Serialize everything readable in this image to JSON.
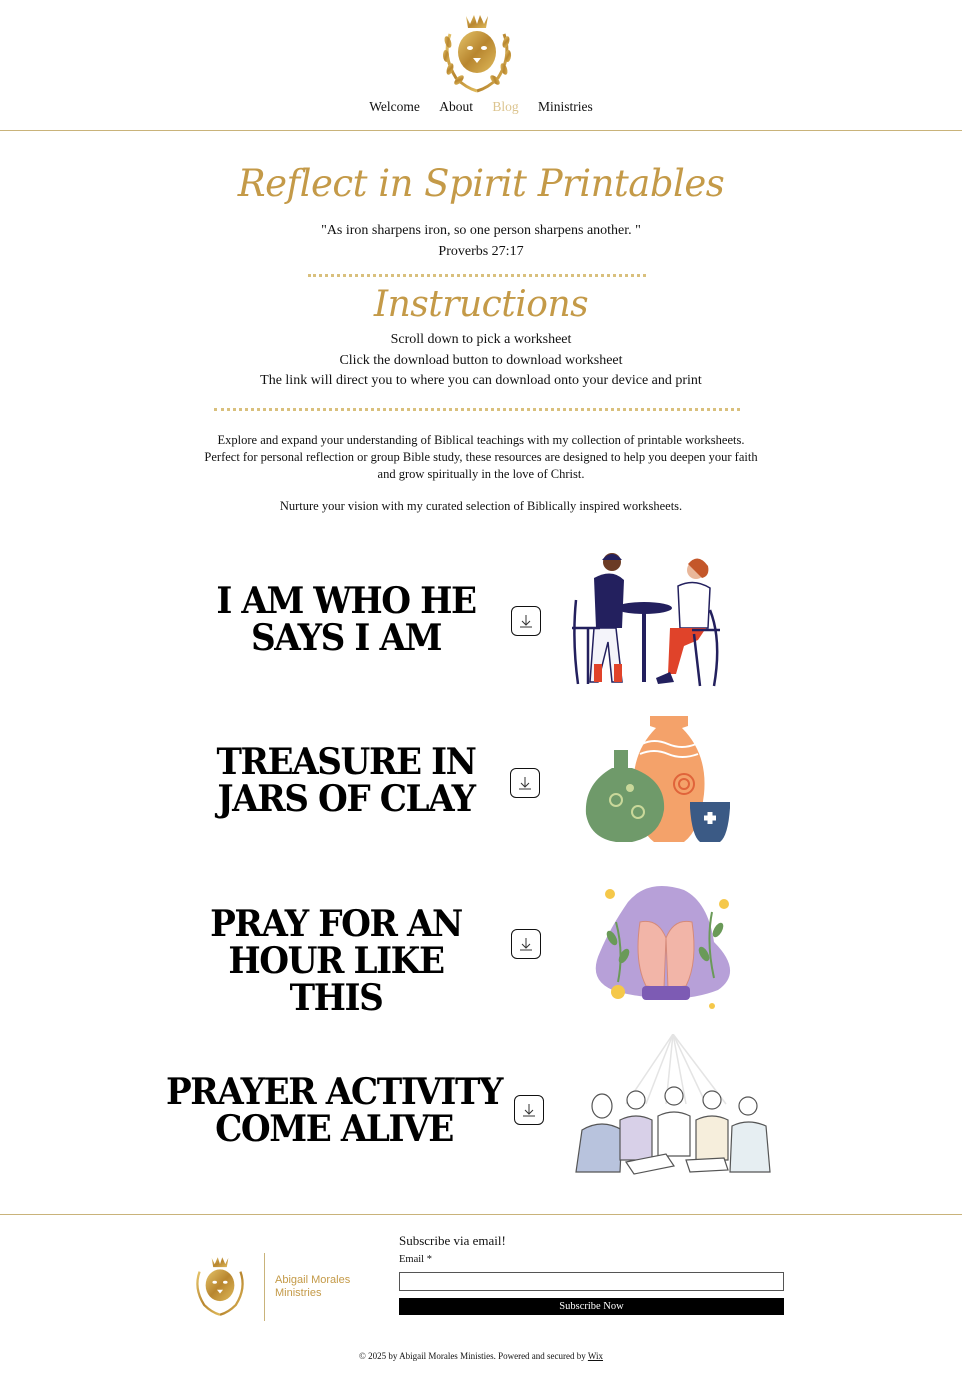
{
  "nav": {
    "items": [
      {
        "label": "Welcome"
      },
      {
        "label": "About"
      },
      {
        "label": "Blog"
      },
      {
        "label": "Ministries"
      }
    ],
    "active": "Blog"
  },
  "hero": {
    "title": "Reflect in Spirit Printables",
    "quote": "\"As iron sharpens iron, so one person sharpens another. \"",
    "reference": "Proverbs 27:17"
  },
  "instructions": {
    "title": "Instructions",
    "lines": [
      "Scroll down to pick a worksheet",
      "Click the download button to download worksheet",
      "The link will direct you to where you can download onto your device and print"
    ]
  },
  "intro": {
    "paragraph_lines": [
      "Explore and expand your understanding of Biblical teachings with my collection of printable worksheets.",
      "Perfect for personal reflection or group Bible study, these resources are designed to help you deepen your faith",
      "and grow spiritually in the love of Christ."
    ],
    "tagline": "Nurture your vision with my curated selection of Biblically inspired worksheets."
  },
  "worksheets": [
    {
      "title_line1": "I AM WHO HE",
      "title_line2": "SAYS  I  AM",
      "icon": "download-icon",
      "image": "two-people-coffee-table"
    },
    {
      "title_line1": "TREASURE IN",
      "title_line2": "JARS OF CLAY",
      "icon": "download-icon",
      "image": "clay-jars"
    },
    {
      "title_line1": "PRAY FOR AN",
      "title_line2": "HOUR  LIKE THIS",
      "icon": "download-icon",
      "image": "praying-hands"
    },
    {
      "title_line1": "PRAYER ACTIVITY",
      "title_line2": "COME ALIVE",
      "icon": "download-icon",
      "image": "group-prayer"
    }
  ],
  "footer": {
    "brand_line1": "Abigail Morales",
    "brand_line2": "Ministries",
    "subscribe_title": "Subscribe via email!",
    "email_label": "Email *",
    "subscribe_button": "Subscribe Now",
    "copyright": "© 2025 by Abigail Morales Ministies. Powered and secured by ",
    "wix_link": "Wix"
  },
  "colors": {
    "gold": "#c49a48",
    "nav_active": "#dcc48f",
    "divider": "#c9b37a"
  }
}
